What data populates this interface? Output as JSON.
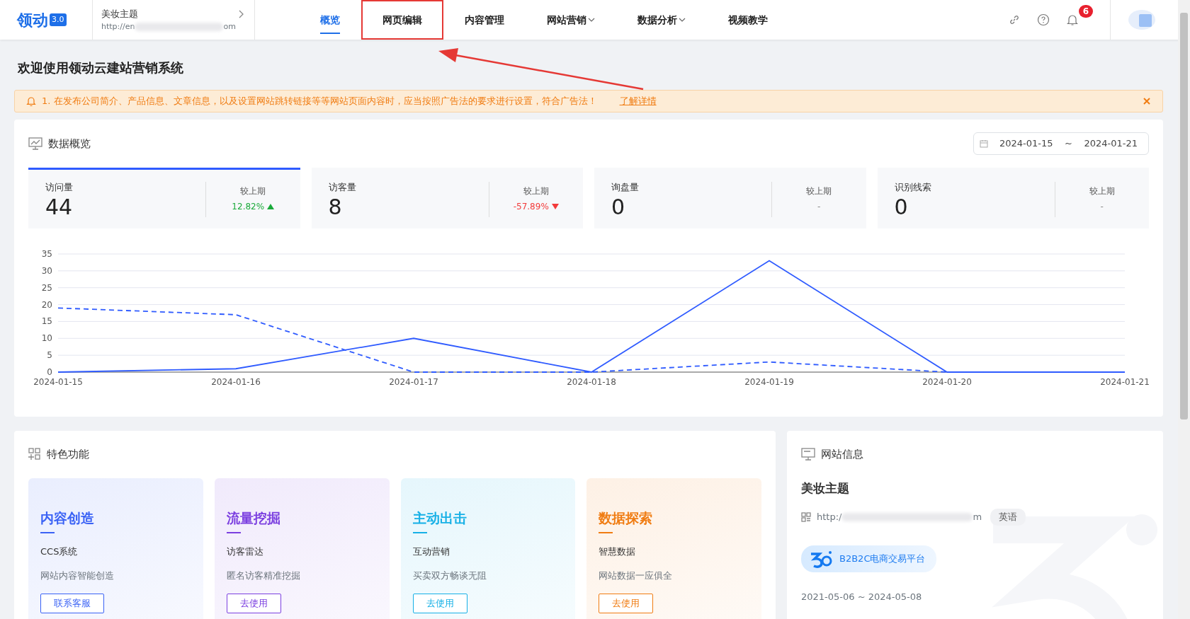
{
  "header": {
    "logo": "领动",
    "logo_badge": "3.0",
    "site": {
      "name": "美妆主题",
      "url_start": "http://en",
      "url_end": "om"
    },
    "tabs": [
      {
        "label": "概览",
        "selected": true,
        "dropdown": false,
        "highlighted": false
      },
      {
        "label": "网页编辑",
        "selected": false,
        "dropdown": false,
        "highlighted": true
      },
      {
        "label": "内容管理",
        "selected": false,
        "dropdown": false,
        "highlighted": false
      },
      {
        "label": "网站营销",
        "selected": false,
        "dropdown": true,
        "highlighted": false
      },
      {
        "label": "数据分析",
        "selected": false,
        "dropdown": true,
        "highlighted": false
      },
      {
        "label": "视频教学",
        "selected": false,
        "dropdown": false,
        "highlighted": false
      }
    ],
    "notification_count": "6"
  },
  "page_title": "欢迎使用领动云建站营销系统",
  "notice": {
    "text": "1. 在发布公司简介、产品信息、文章信息，以及设置网站跳转链接等等网站页面内容时，应当按照广告法的要求进行设置，符合广告法！",
    "link": "了解详情"
  },
  "overview": {
    "title": "数据概览",
    "date_from": "2024-01-15",
    "date_sep": "~",
    "date_to": "2024-01-21",
    "stats": [
      {
        "label": "访问量",
        "value": "44",
        "compare_label": "较上期",
        "change": "12.82%",
        "kind": "up",
        "selected": true
      },
      {
        "label": "访客量",
        "value": "8",
        "compare_label": "较上期",
        "change": "-57.89%",
        "kind": "down",
        "selected": false
      },
      {
        "label": "询盘量",
        "value": "0",
        "compare_label": "较上期",
        "change": "-",
        "kind": "none",
        "selected": false
      },
      {
        "label": "识别线索",
        "value": "0",
        "compare_label": "较上期",
        "change": "-",
        "kind": "none",
        "selected": false
      }
    ],
    "chart_data": {
      "type": "line",
      "categories": [
        "2024-01-15",
        "2024-01-16",
        "2024-01-17",
        "2024-01-18",
        "2024-01-19",
        "2024-01-20",
        "2024-01-21"
      ],
      "ylim": [
        0,
        35
      ],
      "yticks": [
        0,
        5,
        10,
        15,
        20,
        25,
        30,
        35
      ],
      "grid": true,
      "series": [
        {
          "color": "#2f5bff",
          "line_style": "solid",
          "values": [
            0,
            1,
            10,
            0,
            33,
            0,
            0
          ]
        },
        {
          "color": "#2f5bff",
          "line_style": "dashed",
          "values": [
            19,
            17,
            0,
            0,
            3,
            0,
            0
          ]
        }
      ]
    }
  },
  "features": {
    "title": "特色功能",
    "items": [
      {
        "title": "内容创造",
        "subtitle": "CCS系统",
        "description": "网站内容智能创造",
        "button": "联系客服",
        "color": "#3a62f5"
      },
      {
        "title": "流量挖掘",
        "subtitle": "访客雷达",
        "description": "匿名访客精准挖掘",
        "button": "去使用",
        "color": "#7b3fe0"
      },
      {
        "title": "主动出击",
        "subtitle": "互动营销",
        "description": "买卖双方畅谈无阻",
        "button": "去使用",
        "color": "#16b0e6"
      },
      {
        "title": "数据探索",
        "subtitle": "智慧数据",
        "description": "网站数据一应俱全",
        "button": "去使用",
        "color": "#f07c12"
      }
    ]
  },
  "site_info": {
    "title": "网站信息",
    "name": "美妆主题",
    "url_start": "http:/",
    "url_end": "m",
    "language": "英语",
    "plan": "B2B2C电商交易平台",
    "period": "2021-05-06 ~ 2024-05-08"
  }
}
